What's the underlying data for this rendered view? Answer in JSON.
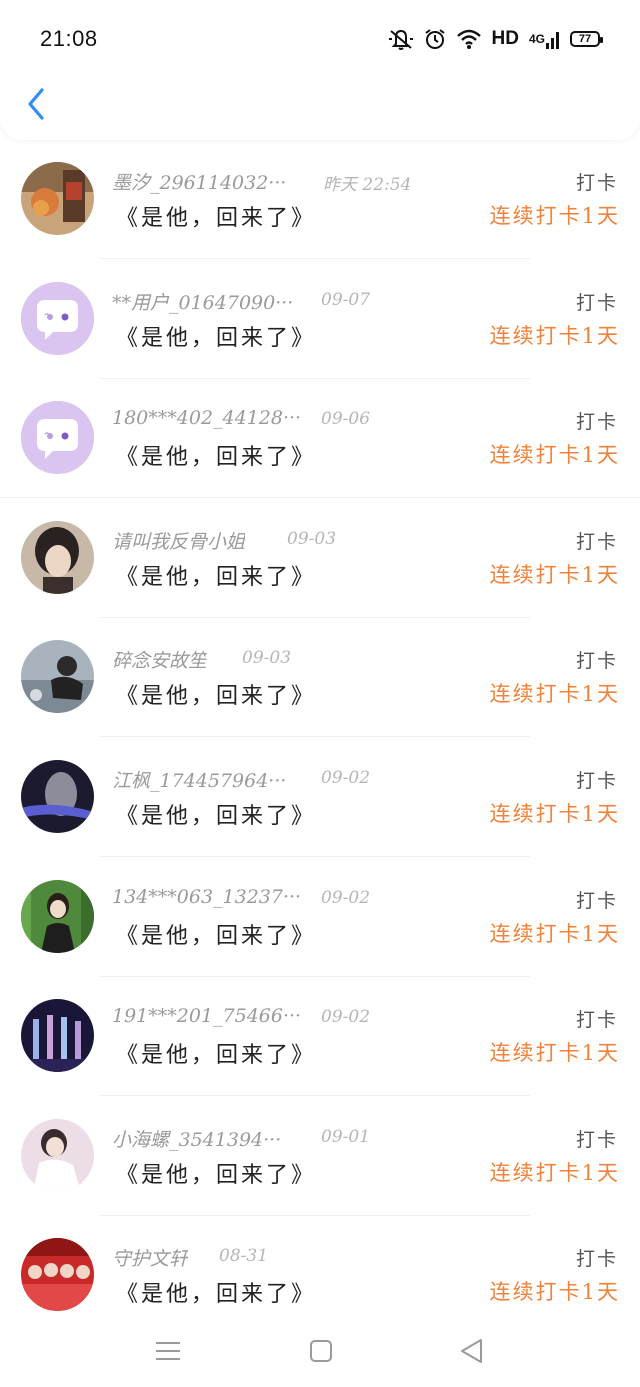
{
  "status_bar": {
    "time": "21:08",
    "hd": "HD",
    "network": "4G",
    "battery": "77"
  },
  "accent_color": "#f0823a",
  "icons": [
    "back-icon",
    "mute-icon",
    "alarm-icon",
    "wifi-icon",
    "signal-icon",
    "battery-icon",
    "menu-icon",
    "home-icon",
    "back-triangle-icon"
  ],
  "rows": [
    {
      "name": "墨汐_296114032···",
      "date": "昨天 22:54",
      "title": "《是他，回来了》",
      "label": "打卡",
      "streak": "连续打卡1天",
      "avatar": "photo-food"
    },
    {
      "name": "**用户_01647090···",
      "date": "09-07",
      "title": "《是他，回来了》",
      "label": "打卡",
      "streak": "连续打卡1天",
      "avatar": "default-chat"
    },
    {
      "name": "180***402_44128···",
      "date": "09-06",
      "title": "《是他，回来了》",
      "label": "打卡",
      "streak": "连续打卡1天",
      "avatar": "default-chat"
    },
    {
      "name": "请叫我反骨小姐",
      "date": "09-03",
      "title": "《是他，回来了》",
      "label": "打卡",
      "streak": "连续打卡1天",
      "avatar": "photo-portrait"
    },
    {
      "name": "碎念安故笙",
      "date": "09-03",
      "title": "《是他，回来了》",
      "label": "打卡",
      "streak": "连续打卡1天",
      "avatar": "photo-outdoor"
    },
    {
      "name": "江枫_174457964···",
      "date": "09-02",
      "title": "《是他，回来了》",
      "label": "打卡",
      "streak": "连续打卡1天",
      "avatar": "photo-dark"
    },
    {
      "name": "134***063_13237···",
      "date": "09-02",
      "title": "《是他，回来了》",
      "label": "打卡",
      "streak": "连续打卡1天",
      "avatar": "photo-green"
    },
    {
      "name": "191***201_75466···",
      "date": "09-02",
      "title": "《是他，回来了》",
      "label": "打卡",
      "streak": "连续打卡1天",
      "avatar": "photo-stage"
    },
    {
      "name": "小海螺_3541394···",
      "date": "09-01",
      "title": "《是他，回来了》",
      "label": "打卡",
      "streak": "连续打卡1天",
      "avatar": "photo-white"
    },
    {
      "name": "守护文轩",
      "date": "08-31",
      "title": "《是他，回来了》",
      "label": "打卡",
      "streak": "连续打卡1天",
      "avatar": "photo-group"
    }
  ]
}
